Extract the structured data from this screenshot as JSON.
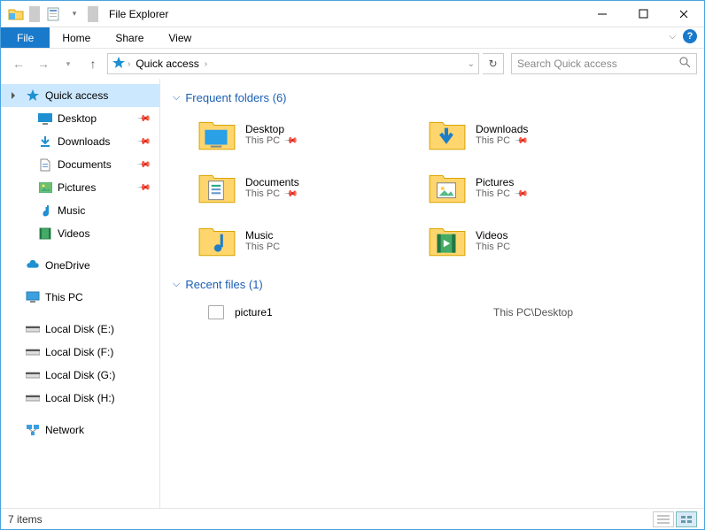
{
  "window": {
    "title": "File Explorer"
  },
  "ribbon": {
    "file": "File",
    "tabs": [
      "Home",
      "Share",
      "View"
    ]
  },
  "nav": {
    "breadcrumb": "Quick access",
    "search_placeholder": "Search Quick access"
  },
  "tree": {
    "quick_access": "Quick access",
    "quick_children": [
      {
        "label": "Desktop",
        "icon": "desktop",
        "pinned": true
      },
      {
        "label": "Downloads",
        "icon": "download",
        "pinned": true
      },
      {
        "label": "Documents",
        "icon": "document",
        "pinned": true
      },
      {
        "label": "Pictures",
        "icon": "picture",
        "pinned": true
      },
      {
        "label": "Music",
        "icon": "music",
        "pinned": false
      },
      {
        "label": "Videos",
        "icon": "video",
        "pinned": false
      }
    ],
    "onedrive": "OneDrive",
    "thispc": "This PC",
    "disks": [
      "Local Disk (E:)",
      "Local Disk (F:)",
      "Local Disk (G:)",
      "Local Disk (H:)"
    ],
    "network": "Network"
  },
  "content": {
    "frequent_header": "Frequent folders (6)",
    "folders": [
      {
        "name": "Desktop",
        "loc": "This PC",
        "icon": "desktop-folder",
        "pinned": true
      },
      {
        "name": "Downloads",
        "loc": "This PC",
        "icon": "download-folder",
        "pinned": true
      },
      {
        "name": "Documents",
        "loc": "This PC",
        "icon": "document-folder",
        "pinned": true
      },
      {
        "name": "Pictures",
        "loc": "This PC",
        "icon": "picture-folder",
        "pinned": true
      },
      {
        "name": "Music",
        "loc": "This PC",
        "icon": "music-folder",
        "pinned": false
      },
      {
        "name": "Videos",
        "loc": "This PC",
        "icon": "video-folder",
        "pinned": false
      }
    ],
    "recent_header": "Recent files (1)",
    "recent": [
      {
        "name": "picture1",
        "path": "This PC\\Desktop"
      }
    ]
  },
  "status": {
    "count": "7 items"
  }
}
